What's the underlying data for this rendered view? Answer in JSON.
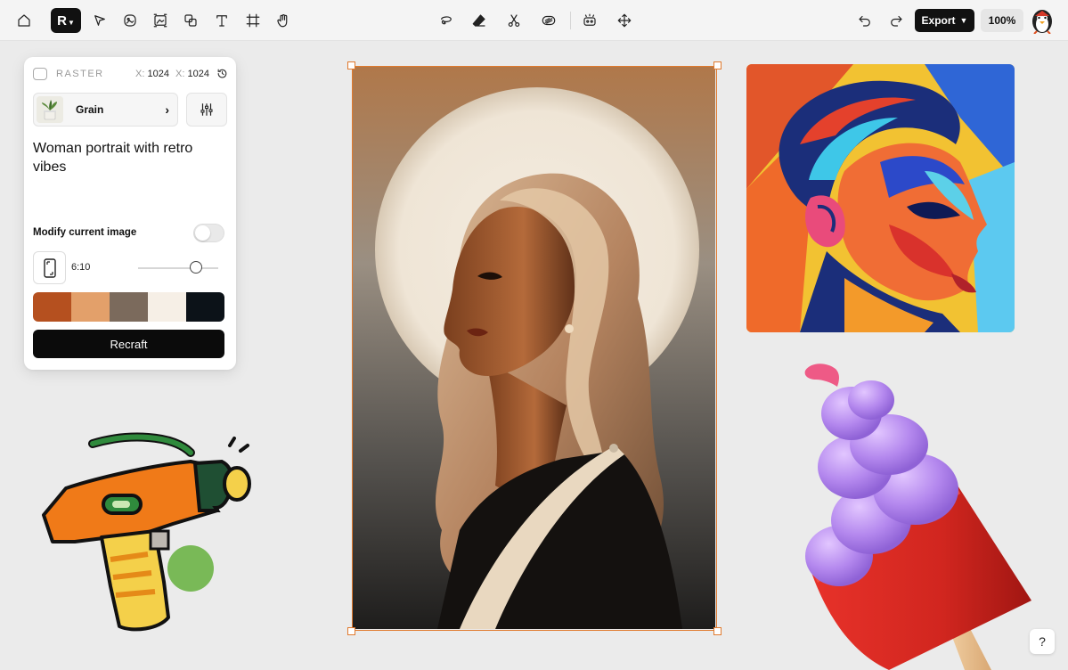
{
  "toolbar": {
    "logo_letter": "R",
    "export_label": "Export",
    "zoom_label": "100%",
    "left_tools": [
      "home-icon",
      "pointer-icon",
      "image-edit-icon",
      "frame-image-icon",
      "layers-icon",
      "text-icon",
      "crop-frame-icon",
      "hand-icon"
    ],
    "center_tools": [
      "lasso-icon",
      "eraser-icon",
      "scissors-icon",
      "vectorize-icon",
      "group-icon",
      "move-icon"
    ],
    "right_tools": [
      "undo-icon",
      "redo-icon"
    ]
  },
  "panel": {
    "mode_label": "RASTER",
    "width_key": "X:",
    "width_value": "1024",
    "height_key": "X:",
    "height_value": "1024",
    "style_name": "Grain",
    "prompt": "Woman portrait with retro vibes",
    "modify_label": "Modify current image",
    "modify_enabled": false,
    "ratio_label": "6:10",
    "slider_value": 0.72,
    "palette": [
      "#b5501f",
      "#e3a06a",
      "#7b6a5c",
      "#f6efe6",
      "#0c1218"
    ],
    "recraft_label": "Recraft"
  },
  "help_label": "?"
}
